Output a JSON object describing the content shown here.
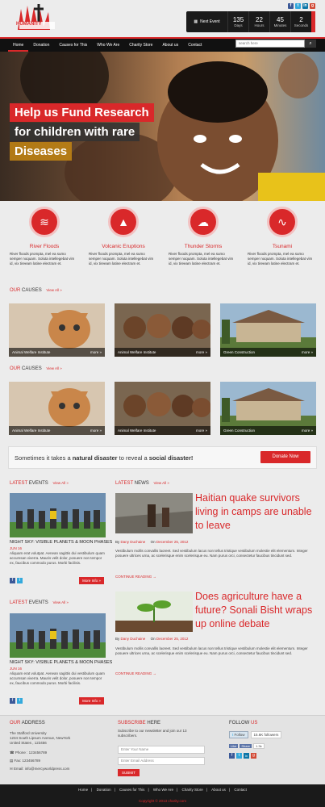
{
  "colors": {
    "accent": "#d9282a",
    "dark": "#1a1a1a",
    "background": "#ececec"
  },
  "header": {
    "logo_text": "HUMANITY",
    "social": [
      {
        "name": "facebook-icon",
        "glyph": "f",
        "color": "#3b5998"
      },
      {
        "name": "twitter-icon",
        "glyph": "t",
        "color": "#33a9dc"
      },
      {
        "name": "linkedin-icon",
        "glyph": "in",
        "color": "#0e76a8"
      },
      {
        "name": "google-plus-icon",
        "glyph": "g",
        "color": "#d24a36"
      }
    ],
    "countdown": {
      "label": "Next Event",
      "units": [
        {
          "value": "135",
          "label": "Days"
        },
        {
          "value": "22",
          "label": "Hours"
        },
        {
          "value": "45",
          "label": "Minutes"
        },
        {
          "value": "2",
          "label": "Seconds"
        }
      ]
    }
  },
  "nav": {
    "items": [
      "Home",
      "Donation",
      "Causes for This",
      "Who We Are",
      "Charity Store",
      "About us",
      "Contact"
    ],
    "search_placeholder": "search here"
  },
  "hero": {
    "lines": [
      "Help us Fund Research",
      "for children with rare",
      "Diseases"
    ]
  },
  "features": [
    {
      "title": "River Floods",
      "text": "River floods prompta, mel ea sumo semper noquam. Soluta intellegebat vim id, vix tireeam latine electram et.",
      "icon": "flood-icon"
    },
    {
      "title": "Volcanic Eruptions",
      "text": "River floods prompta, mel ea sumo semper noquam. Soluta intellegebat vim id, vix tireeam latine electram et.",
      "icon": "volcano-icon"
    },
    {
      "title": "Thunder Storms",
      "text": "River floods prompta, mel ea sumo semper noquam. Soluta intellegebat vim id, vix tireeam latine electram et.",
      "icon": "storm-icon"
    },
    {
      "title": "Tsunami",
      "text": "River floods prompta, mel ea sumo semper noquam. Soluta intellegebat vim id, vix tireeam latine electram et.",
      "icon": "tsunami-icon"
    }
  ],
  "causes": {
    "title_red": "OUR",
    "title": "CAUSES",
    "view_all": "View All »",
    "more": "more »",
    "rows": [
      [
        {
          "caption": "Animal Welfare Institute"
        },
        {
          "caption": "Animal Welfare Institute"
        },
        {
          "caption": "Green Construction"
        }
      ],
      [
        {
          "caption": "Animal Welfare Institute"
        },
        {
          "caption": "Animal Welfare Institute"
        },
        {
          "caption": "Green Construction"
        }
      ]
    ]
  },
  "donate": {
    "text_pre": "Sometimes it takes a ",
    "text_b1": "natural disaster",
    "text_mid": " to reveal a ",
    "text_b2": "social disaster!",
    "button": "Donate Now"
  },
  "events": {
    "title_red": "LATEST",
    "title": "EVENTS",
    "view_all": "View All »",
    "items": [
      {
        "title": "NIGHT SKY: VISIBLE PLANETS & MOON PHASES",
        "date": "JUN 16",
        "text": "Aliquam erat volutpat. Aenean sagittis dui vestibulum quam accumsan viverra. Mauris velit dolor, posuere non tempor ex, faucibus commodo purus. Morbi facilisis.",
        "more": "More Info »"
      },
      {
        "title": "NIGHT SKY: VISIBLE PLANETS & MOON PHASES",
        "date": "JUN 16",
        "text": "Aliquam erat volutpat. Aenean sagittis dui vestibulum quam accumsan viverra. Mauris velit dolor, posuere non tempor ex, faucibus commodo purus. Morbi facilisis.",
        "more": "More Info »"
      }
    ]
  },
  "news": {
    "title_red": "LATEST",
    "title": "NEWS",
    "view_all": "View All »",
    "items": [
      {
        "title": "Haitian quake survivors living in camps are unable to leave",
        "by": "By",
        "author": "Dany Duchaine",
        "on": "On",
        "date": "December 25, 2012",
        "text": "Vestibulum mollis convallis laoreet. Sed vestibulum lacus non tellus tristique vestibulum molestie elit elementum. Integer posuere ultrices urna, ac scelerisque enim scelerisque eu. Nam purus orci, consectetur faucibus tincidunt sed.",
        "continue": "CONTINUE READING →"
      },
      {
        "title": "Does agriculture have a future? Sonali Bisht wraps up online debate",
        "by": "By",
        "author": "Dany Duchaine",
        "on": "On",
        "date": "December 25, 2012",
        "text": "Vestibulum mollis convallis laoreet. Sed vestibulum lacus non tellus tristique vestibulum molestie elit elementum. Integer posuere ultrices urna, ac scelerisque enim scelerisque eu. Nam purus orci, consectetur faucibus tincidunt sed.",
        "continue": "CONTINUE READING →"
      }
    ]
  },
  "footer": {
    "address": {
      "title_red": "OUR",
      "title": "ADDRESS",
      "lines": [
        "The Stafford University",
        "1234 South Lipsum Avenue, NewYork",
        "United States , 123456"
      ],
      "phone": "Phone : 123456789",
      "fax": "Fax: 123456789",
      "email": "Email: info@mercyworldpress.com"
    },
    "subscribe": {
      "title_red": "SUBSCRIBE",
      "title": "HERE",
      "text": "Subscribe to our newsletter and join our 13 subscribers.",
      "name_placeholder": "Enter Your Name",
      "email_placeholder": "Enter Email Address",
      "button": "SUBMIT"
    },
    "follow": {
      "title": "FOLLOW",
      "title_red": "US",
      "twitter_button": "Follow",
      "followers": "15.6K followers",
      "like": "Like",
      "share": "Share",
      "like_count": "1.3k"
    },
    "nav": [
      "Home",
      "Donation",
      "Causes for This",
      "Who We Are",
      "Charity Store",
      "About us",
      "Contact"
    ],
    "copyright": "Copyright © 2013 charity.com"
  }
}
